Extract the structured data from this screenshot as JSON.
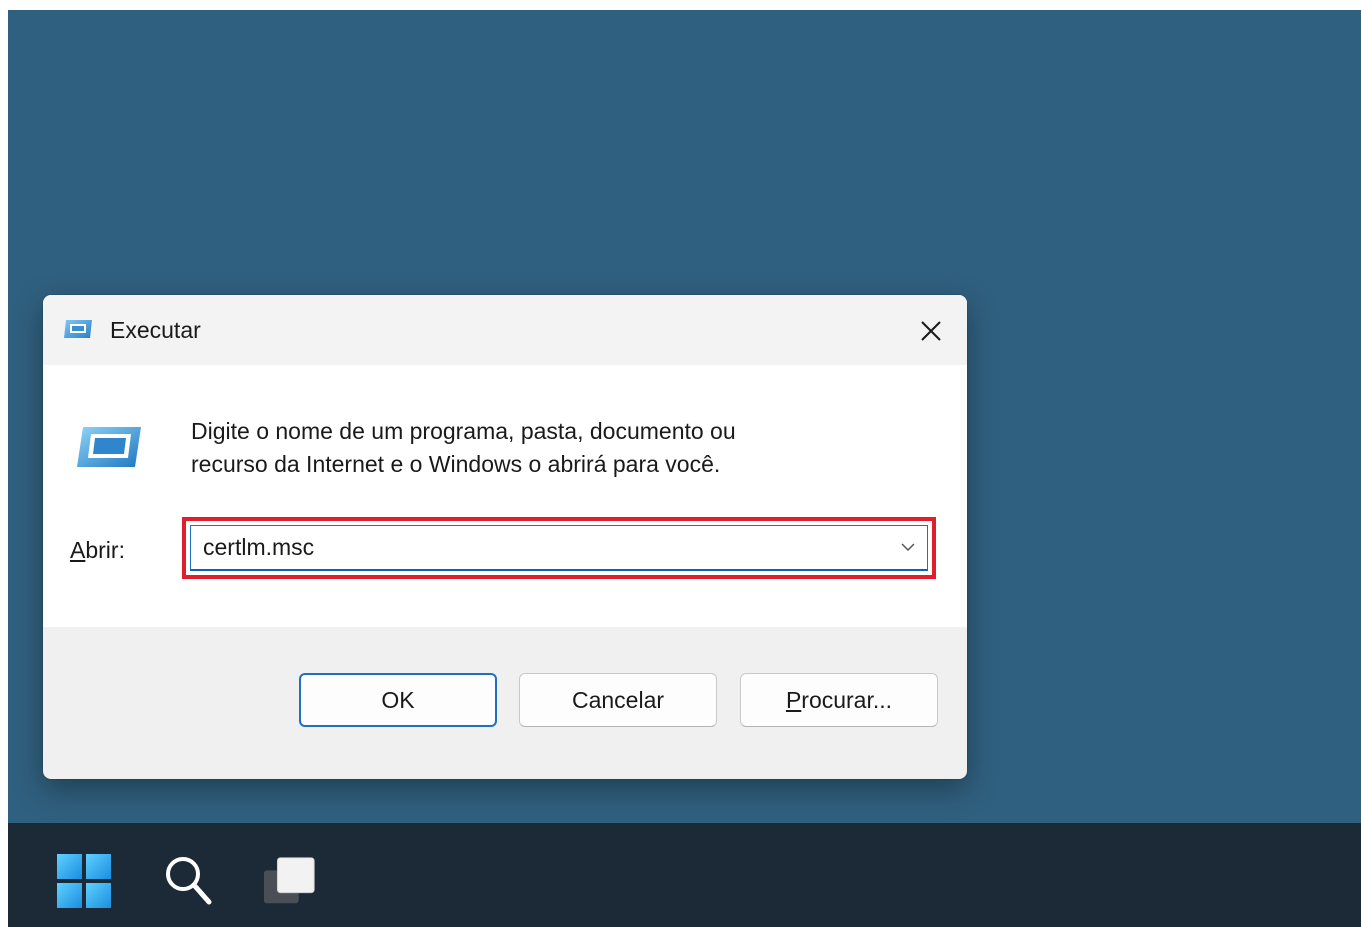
{
  "dialog": {
    "title": "Executar",
    "description": "Digite o nome de um programa, pasta, documento ou\nrecurso da Internet e o Windows o abrirá para você.",
    "open_label_mnemonic": "A",
    "open_label_rest": "brir:",
    "open_value": "certlm.msc",
    "buttons": {
      "ok": "OK",
      "cancel": "Cancelar",
      "browse_mnemonic": "P",
      "browse_rest": "rocurar..."
    }
  },
  "colors": {
    "desktop": "#30607f",
    "taskbar": "#1b2a36",
    "highlight": "#e01e2d",
    "accent": "#1f6fc2"
  },
  "taskbar": {
    "icons": [
      "windows-start-icon",
      "search-icon",
      "task-view-icon"
    ]
  }
}
